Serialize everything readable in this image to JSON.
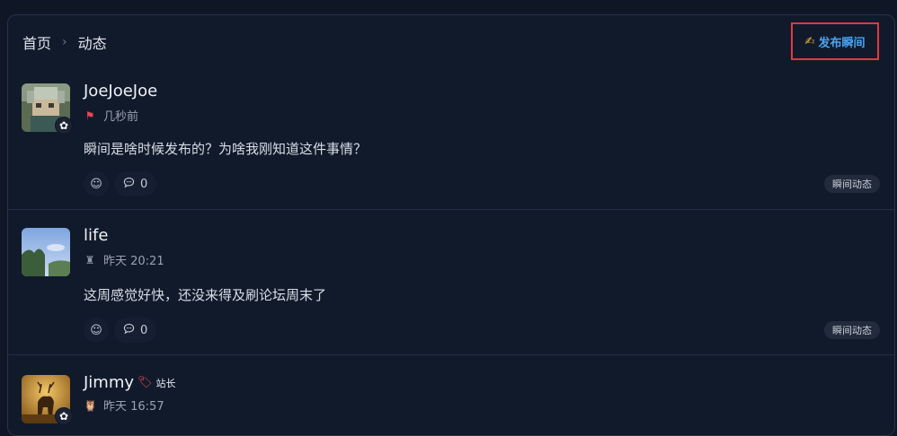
{
  "breadcrumb": {
    "home": "首页",
    "separator": "›",
    "current": "动态"
  },
  "publish": {
    "icon": "writing-hand-icon",
    "label": "发布瞬间"
  },
  "posts": [
    {
      "username": "JoeJoeJoe",
      "time": "几秒前",
      "meta_icon": "flag-icon",
      "content": "瞬间是啥时候发布的？为啥我刚知道这件事情？",
      "reaction_icon": "smiley-icon",
      "comment_count": "0",
      "chip": "瞬间动态",
      "has_flower_badge": true
    },
    {
      "username": "life",
      "time": "昨天 20:21",
      "meta_icon": "statue-icon",
      "content": "这周感觉好快，还没来得及刷论坛周末了",
      "reaction_icon": "smiley-icon",
      "comment_count": "0",
      "chip": "瞬间动态",
      "has_flower_badge": false
    },
    {
      "username": "Jimmy",
      "role": "站长",
      "time": "昨天 16:57",
      "meta_icon": "owl-icon",
      "has_flower_badge": true
    }
  ],
  "icons": {
    "flower": "✿",
    "smiley": "☺",
    "comment": "💬"
  },
  "colors": {
    "background": "#0f1626",
    "panel": "#111a2b",
    "accent_blue": "#4aa3f0",
    "highlight_red": "#e0393e"
  }
}
